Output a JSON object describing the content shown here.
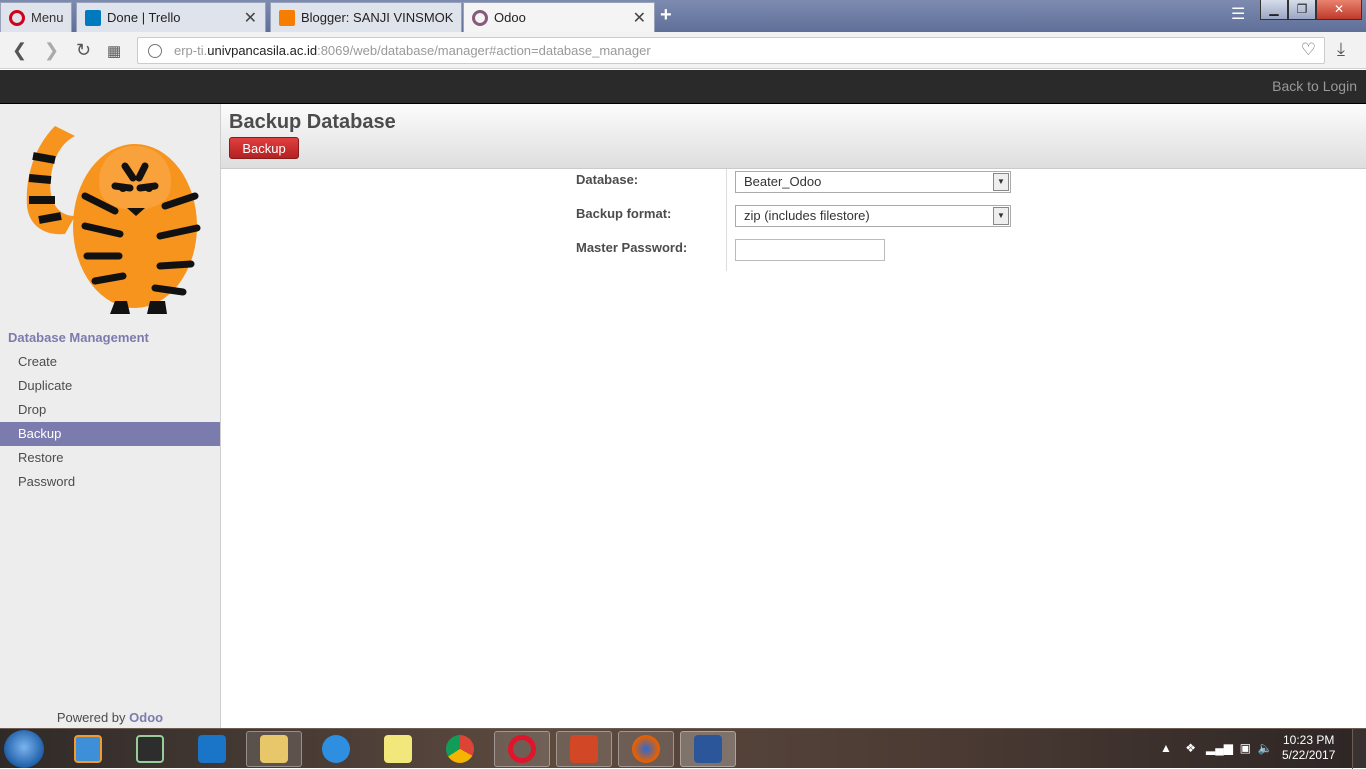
{
  "browser": {
    "menu_label": "Menu",
    "tabs": [
      {
        "title": "Done | Trello",
        "color": "#0079bf"
      },
      {
        "title": "Blogger: SANJI VINSMOKE",
        "color": "#f57d00"
      },
      {
        "title": "Odoo",
        "color": "#875a7b"
      }
    ],
    "url_host": "erp-ti.univpancasila.ac.id",
    "url_rest": ":8069/web/database/manager#action=database_manager",
    "url_prefix": "erp-ti."
  },
  "topbar": {
    "back_to_login": "Back to Login"
  },
  "sidebar": {
    "section_title": "Database Management",
    "items": [
      {
        "label": "Create"
      },
      {
        "label": "Duplicate"
      },
      {
        "label": "Drop"
      },
      {
        "label": "Backup",
        "active": true
      },
      {
        "label": "Restore"
      },
      {
        "label": "Password"
      }
    ],
    "powered_by": "Powered by",
    "powered_brand": "Odoo"
  },
  "main": {
    "title": "Backup Database",
    "backup_button": "Backup",
    "form": {
      "database_label": "Database:",
      "database_value": "Beater_Odoo",
      "format_label": "Backup format:",
      "format_value": "zip (includes filestore)",
      "password_label": "Master Password:",
      "password_value": ""
    }
  },
  "taskbar": {
    "time": "10:23 PM",
    "date": "5/22/2017"
  },
  "colors": {
    "accent": "#7c7bad",
    "button_red": "#c22b2b",
    "topbar": "#2a2a2a"
  }
}
